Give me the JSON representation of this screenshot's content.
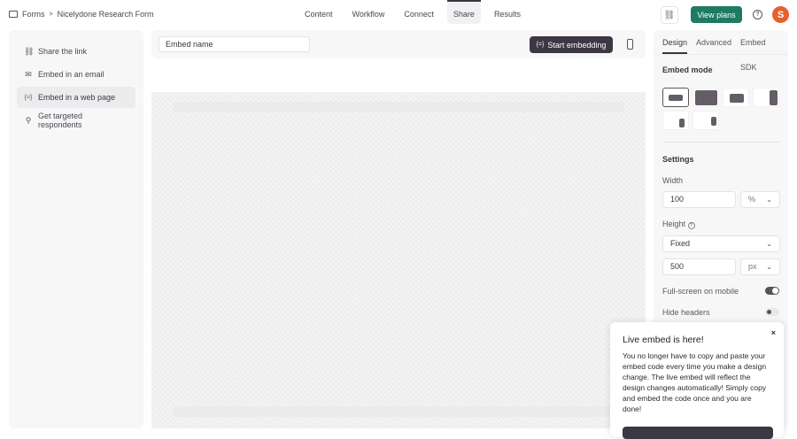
{
  "breadcrumb": {
    "root": "Forms",
    "separator": ">",
    "current": "Nicelydone Research Form"
  },
  "nav": {
    "tabs": [
      "Content",
      "Workflow",
      "Connect",
      "Share",
      "Results"
    ],
    "active": "Share"
  },
  "header": {
    "view_plans": "View plans",
    "help": "?",
    "avatar": "S"
  },
  "sidebar": {
    "items": [
      {
        "label": "Share the link",
        "icon": "⛓"
      },
      {
        "label": "Embed in an email",
        "icon": "✉"
      },
      {
        "label": "Embed in a web page",
        "icon": "{=}"
      },
      {
        "label": "Get targeted respondents",
        "icon": "⚲"
      }
    ]
  },
  "toolbar": {
    "embed_name_placeholder": "Embed name",
    "start_label": "Start embedding",
    "start_icon": "{=}"
  },
  "panel": {
    "tabs": [
      "Design",
      "Advanced",
      "Embed SDK"
    ],
    "embed_mode": "Embed mode",
    "settings": "Settings",
    "width_label": "Width",
    "width_value": "100",
    "width_unit": "%",
    "height_label": "Height",
    "height_mode": "Fixed",
    "height_value": "500",
    "height_unit": "px",
    "fullscreen_label": "Full-screen on mobile",
    "fullscreen_on": true,
    "hide_headers_label": "Hide headers",
    "hide_headers_on": false,
    "info": "?"
  },
  "popup": {
    "title": "Live embed is here!",
    "body": "You no longer have to copy and paste your embed code every time you make a design change. The live embed will reflect the design changes automatically! Simply copy and embed the code once and you are done!",
    "close": "×"
  },
  "colors": {
    "brand": "#1f7a64",
    "dark": "#3d3643",
    "avatar": "#e8602c"
  }
}
